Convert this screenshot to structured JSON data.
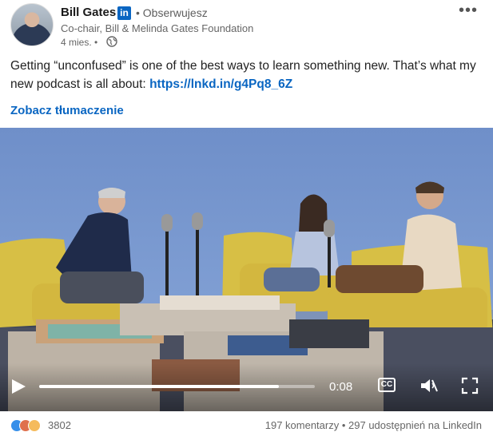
{
  "author": {
    "name": "Bill Gates",
    "network_badge": "in",
    "follow_status": "• Obserwujesz",
    "headline": "Co-chair, Bill & Melinda Gates Foundation",
    "time_ago": "4 mies. •",
    "visibility_icon": "globe-icon"
  },
  "menu": {
    "more_label": "•••"
  },
  "post": {
    "text": "Getting “unconfused” is one of the best ways to learn something new. That’s what my new podcast is all about: ",
    "link": "https://lnkd.in/g4Pq8_6Z",
    "translate_label": "Zobacz tłumaczenie"
  },
  "video": {
    "current_time": "0:08",
    "progress_fraction": 0.87,
    "cc_label": "CC",
    "muted": true
  },
  "social": {
    "reactions": [
      "like-icon",
      "love-icon",
      "insightful-icon"
    ],
    "reaction_count": "3802",
    "comments": "197 komentarzy",
    "separator": " • ",
    "shares": "297 udostępnień na LinkedIn"
  },
  "colors": {
    "link": "#0a66c2",
    "muted_text": "#666666"
  }
}
